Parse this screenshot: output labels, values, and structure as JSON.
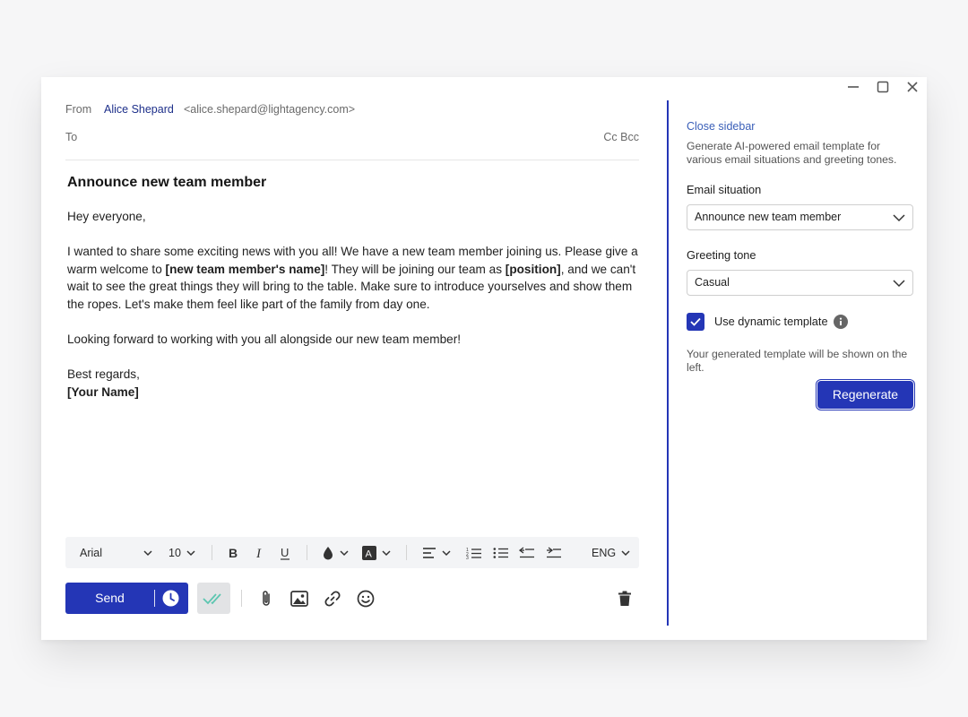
{
  "window": {
    "controls": [
      "minimize",
      "maximize",
      "close"
    ]
  },
  "header": {
    "from_label": "From",
    "from_name": "Alice Shepard",
    "from_email": "<alice.shepard@lightagency.com>",
    "to_label": "To",
    "cc_bcc": "Cc Bcc"
  },
  "email": {
    "subject": "Announce new team member",
    "greeting": "Hey everyone,",
    "p1_a": "I wanted to share some exciting news with you all! We have a new team member joining us. Please give a warm welcome to ",
    "p1_name": "[new team member's name]",
    "p1_b": "! They will be joining our team as ",
    "p1_position": "[position]",
    "p1_c": ", and we can't wait to see the great things they will bring to the table. Make sure to introduce yourselves and show them the ropes. Let's make them feel like part of the family from day one.",
    "p2": "Looking forward to working with you all alongside our new team member!",
    "signoff": "Best regards,",
    "signature": "[Your Name]"
  },
  "toolbar": {
    "font": "Arial",
    "size": "10",
    "language": "ENG",
    "icons": [
      "bold-icon",
      "italic-icon",
      "underline-icon",
      "color-drop-icon",
      "text-highlight-icon",
      "align-left-icon",
      "numbered-list-icon",
      "bullet-list-icon",
      "outdent-icon",
      "indent-icon"
    ]
  },
  "actions": {
    "send_label": "Send",
    "icons": [
      "schedule-clock-icon",
      "double-check-icon",
      "attachment-icon",
      "image-icon",
      "link-icon",
      "emoji-icon",
      "trash-icon"
    ]
  },
  "sidebar": {
    "close_label": "Close sidebar",
    "description": "Generate AI-powered email template for various email situations and greeting tones.",
    "situation_label": "Email situation",
    "situation_value": "Announce new team member",
    "tone_label": "Greeting tone",
    "tone_value": "Casual",
    "dynamic_label": "Use dynamic template",
    "dynamic_checked": true,
    "note": "Your generated template will be shown on the left.",
    "regenerate_label": "Regenerate"
  },
  "colors": {
    "accent": "#2436b6",
    "link": "#3a5fb8",
    "from_name": "#1d2f8a",
    "check_teal": "#5cc6b0"
  }
}
